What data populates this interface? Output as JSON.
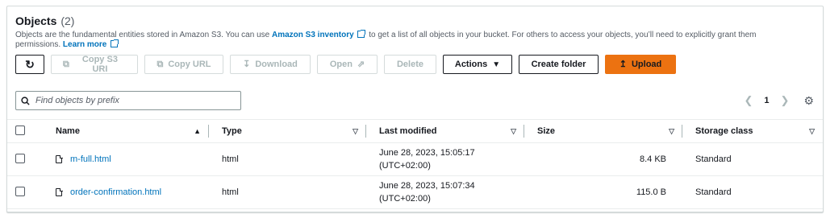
{
  "header": {
    "title": "Objects",
    "count": "(2)",
    "description_pre": "Objects are the fundamental entities stored in Amazon S3. You can use ",
    "inventory_link": "Amazon S3 inventory",
    "description_mid": " to get a list of all objects in your bucket. For others to access your objects, you’ll need to explicitly grant them permissions. ",
    "learn_more": "Learn more"
  },
  "toolbar": {
    "copy_s3_uri": "Copy S3 URI",
    "copy_url": "Copy URL",
    "download": "Download",
    "open": "Open",
    "delete": "Delete",
    "actions": "Actions",
    "create_folder": "Create folder",
    "upload": "Upload"
  },
  "search": {
    "placeholder": "Find objects by prefix"
  },
  "pagination": {
    "page": "1"
  },
  "table": {
    "columns": [
      "Name",
      "Type",
      "Last modified",
      "Size",
      "Storage class"
    ],
    "rows": [
      {
        "name": "m-full.html",
        "type": "html",
        "modified_line1": "June 28, 2023, 15:05:17",
        "modified_line2": "(UTC+02:00)",
        "size": "8.4 KB",
        "storage": "Standard"
      },
      {
        "name": "order-confirmation.html",
        "type": "html",
        "modified_line1": "June 28, 2023, 15:07:34",
        "modified_line2": "(UTC+02:00)",
        "size": "115.0 B",
        "storage": "Standard"
      }
    ]
  },
  "colors": {
    "accent": "#ec7211",
    "link": "#0073bb"
  }
}
